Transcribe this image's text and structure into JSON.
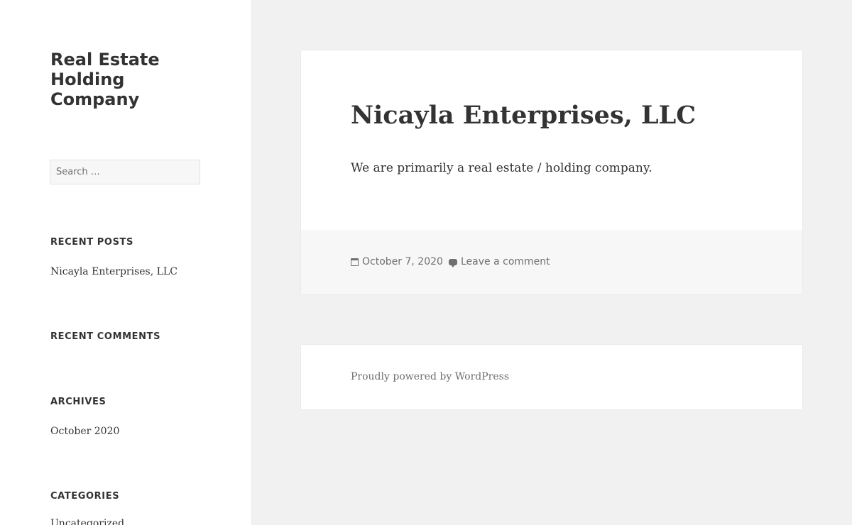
{
  "site": {
    "title": "Real Estate Holding Company"
  },
  "search": {
    "placeholder": "Search …"
  },
  "widgets": {
    "recent_posts": {
      "title": "Recent Posts",
      "items": [
        "Nicayla Enterprises, LLC"
      ]
    },
    "recent_comments": {
      "title": "Recent Comments"
    },
    "archives": {
      "title": "Archives",
      "items": [
        "October 2020"
      ]
    },
    "categories": {
      "title": "Categories",
      "items": [
        "Uncategorized"
      ]
    }
  },
  "post": {
    "title": "Nicayla Enterprises, LLC",
    "body": "We are primarily a real estate / holding company.",
    "date": "October 7, 2020",
    "comment_link": "Leave a comment"
  },
  "footer": {
    "credit": "Proudly powered by WordPress"
  },
  "colors": {
    "background": "#f1f1f1",
    "card": "#ffffff",
    "meta_background": "#f7f7f7",
    "text": "#333333",
    "muted_text": "#707070"
  }
}
